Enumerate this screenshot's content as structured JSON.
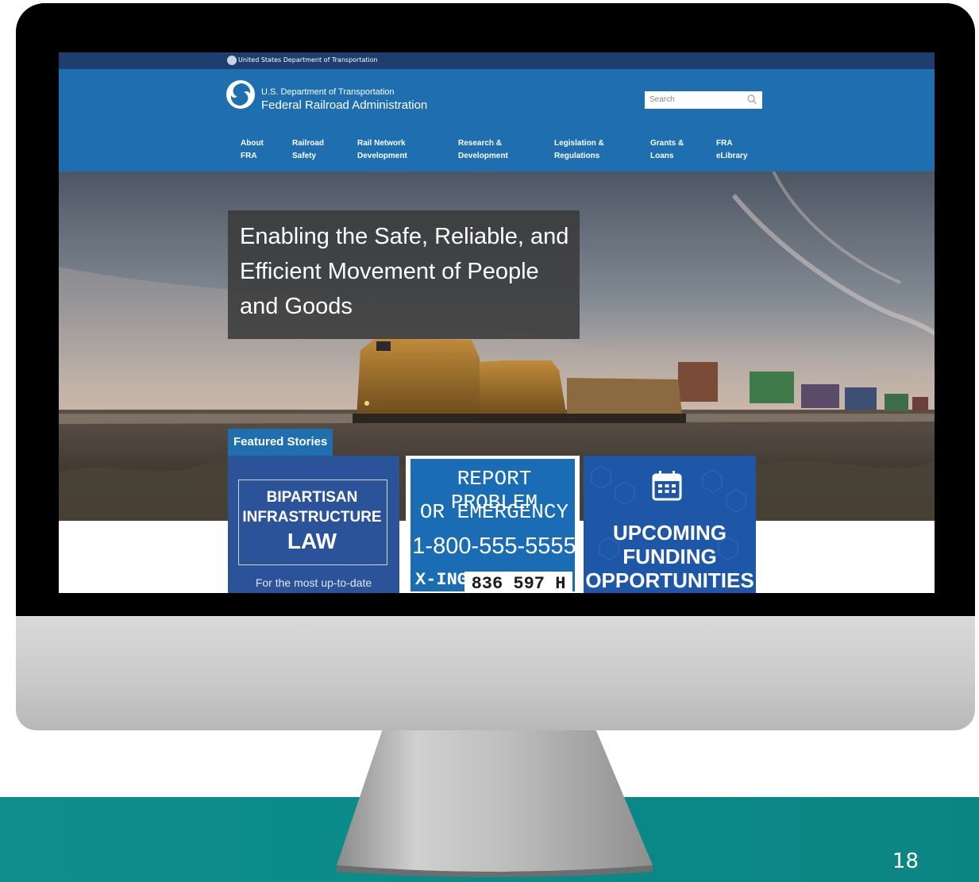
{
  "slide": {
    "number": "18"
  },
  "site": {
    "gov_banner": "United States Department of Transportation",
    "logo": {
      "line1": "U.S. Department of Transportation",
      "line2": "Federal Railroad Administration"
    },
    "search": {
      "placeholder": "Search"
    },
    "nav": [
      {
        "line1": "About",
        "line2": "FRA"
      },
      {
        "line1": "Railroad",
        "line2": "Safety"
      },
      {
        "line1": "Rail Network",
        "line2": "Development"
      },
      {
        "line1": "Research &",
        "line2": "Development"
      },
      {
        "line1": "Legislation &",
        "line2": "Regulations"
      },
      {
        "line1": "Grants &",
        "line2": "Loans"
      },
      {
        "line1": "FRA",
        "line2": "eLibrary"
      }
    ],
    "hero": {
      "title_lines": [
        "Enabling the Safe, Reliable, and",
        "Efficient Movement of People",
        "and Goods"
      ]
    },
    "featured": {
      "label": "Featured Stories",
      "card1": {
        "line1": "BIPARTISAN",
        "line2": "INFRASTRUCTURE",
        "line3": "LAW",
        "footer": "For the most up-to-date"
      },
      "card2": {
        "line1": "REPORT PROBLEM",
        "line2": "OR EMERGENCY",
        "line3": "1-800-555-5555",
        "xing_label": "X-ING",
        "xing_number": "836 597 H"
      },
      "card3": {
        "line1": "UPCOMING",
        "line2": "FUNDING",
        "line3": "OPPORTUNITIES"
      }
    }
  },
  "colors": {
    "gov_bar": "#1d3e6e",
    "header_blue": "#1e6eb0",
    "teal_band": "#0a8a8a"
  }
}
